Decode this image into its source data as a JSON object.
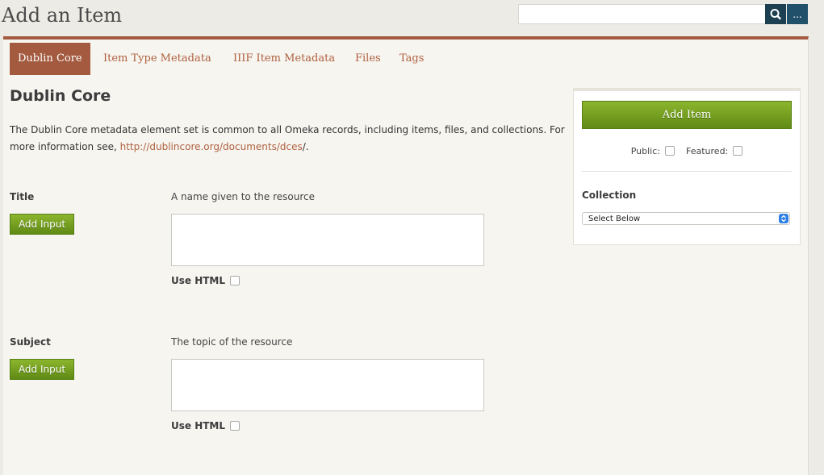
{
  "page": {
    "title": "Add an Item"
  },
  "search": {
    "value": "",
    "placeholder": "",
    "more_label": "..."
  },
  "tabs": [
    {
      "label": "Dublin Core",
      "active": true
    },
    {
      "label": "Item Type Metadata",
      "active": false
    },
    {
      "label": "IIIF Item Metadata",
      "active": false
    },
    {
      "label": "Files",
      "active": false
    },
    {
      "label": "Tags",
      "active": false
    }
  ],
  "section": {
    "title": "Dublin Core",
    "intro_before": "The Dublin Core metadata element set is common to all Omeka records, including items, files, and collections. For more information see, ",
    "intro_link": "http://dublincore.org/documents/dces",
    "intro_after": "/."
  },
  "fields": [
    {
      "label": "Title",
      "description": "A name given to the resource",
      "add_input_label": "Add Input",
      "value": "",
      "use_html_label": "Use HTML",
      "use_html_checked": false
    },
    {
      "label": "Subject",
      "description": "The topic of the resource",
      "add_input_label": "Add Input",
      "value": "",
      "use_html_label": "Use HTML",
      "use_html_checked": false
    }
  ],
  "sidebar": {
    "add_item_label": "Add Item",
    "public_label": "Public:",
    "public_checked": false,
    "featured_label": "Featured:",
    "featured_checked": false,
    "collection_label": "Collection",
    "collection_selected": "Select Below"
  },
  "colors": {
    "accent": "#a35a3f",
    "link": "#b0603f",
    "button_green": "#6f9b1d",
    "search_button": "#1d3f52",
    "background": "#ecebe5"
  },
  "icons": {
    "search": "search-icon",
    "select": "select-arrows-icon"
  }
}
